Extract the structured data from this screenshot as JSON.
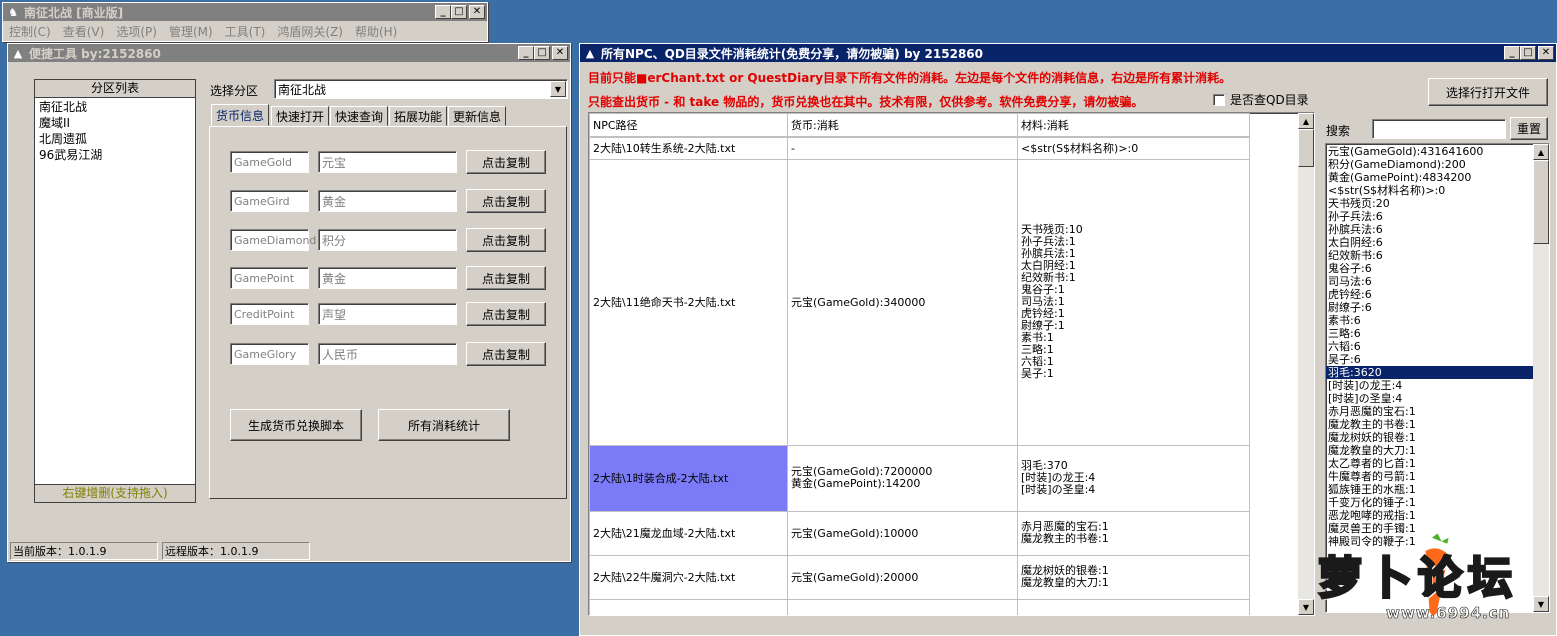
{
  "main_window": {
    "title": "南征北战 [商业版]",
    "menu": [
      "控制(C)",
      "查看(V)",
      "选项(P)",
      "管理(M)",
      "工具(T)",
      "鸿盾网关(Z)",
      "帮助(H)"
    ]
  },
  "tool_window": {
    "title": "便捷工具  by:2152860",
    "partition_list": {
      "header": "分区列表",
      "items": [
        "南征北战",
        "魔域II",
        "北周遗孤",
        "96武易江湖"
      ],
      "footer": "右键增删(支持拖入)"
    },
    "select_label": "选择分区",
    "select_value": "南征北战",
    "tabs": [
      "货币信息",
      "快速打开",
      "快速查询",
      "拓展功能",
      "更新信息"
    ],
    "currency_rows": [
      {
        "code": "GameGold",
        "name": "元宝",
        "button": "点击复制"
      },
      {
        "code": "GameGird",
        "name": "黄金",
        "button": "点击复制"
      },
      {
        "code": "GameDiamond",
        "name": "积分",
        "button": "点击复制"
      },
      {
        "code": "GamePoint",
        "name": "黄金",
        "button": "点击复制"
      },
      {
        "code": "CreditPoint",
        "name": "声望",
        "button": "点击复制"
      },
      {
        "code": "GameGlory",
        "name": "人民币",
        "button": "点击复制"
      }
    ],
    "gen_button": "生成货币兑换脚本",
    "stats_button": "所有消耗统计",
    "status_current": "当前版本：1.0.1.9",
    "status_remote": "远程版本：1.0.1.9"
  },
  "stats_window": {
    "title": "所有NPC、QD目录文件消耗统计(免费分享，请勿被骗)    by 2152860",
    "notice1": "目前只能■erChant.txt or QuestDiary目录下所有文件的消耗。左边是每个文件的消耗信息，右边是所有累计消耗。",
    "notice2": "只能查出货币 - 和 take 物品的，货币兑换也在其中。技术有限，仅供参考。软件免费分享，请勿被骗。",
    "qd_checkbox": "是否查QD目录",
    "open_button": "选择行打开文件",
    "search_label": "搜索",
    "reset_button": "重置",
    "columns": [
      "NPC路径",
      "货币:消耗",
      "材料:消耗"
    ],
    "rows": [
      {
        "path": "2大陆\\10转生系统-2大陆.txt",
        "currency": [
          "-"
        ],
        "materials": [
          "<$str(S$材料名称)>:0"
        ]
      },
      {
        "path": "2大陆\\11绝命天书-2大陆.txt",
        "currency": [
          "元宝(GameGold):340000"
        ],
        "materials": [
          "天书残页:10",
          "孙子兵法:1",
          "孙膑兵法:1",
          "太白阴经:1",
          "纪效新书:1",
          "鬼谷子:1",
          "司马法:1",
          "虎钤经:1",
          "尉缭子:1",
          "素书:1",
          "三略:1",
          "六韬:1",
          "吴子:1"
        ]
      },
      {
        "path": "2大陆\\1时装合成-2大陆.txt",
        "currency": [
          "元宝(GameGold):7200000",
          "黄金(GamePoint):14200"
        ],
        "materials": [
          "羽毛:370",
          "[时装]の龙王:4",
          "[时装]の圣皇:4"
        ]
      },
      {
        "path": "2大陆\\21魔龙血域-2大陆.txt",
        "currency": [
          "元宝(GameGold):10000"
        ],
        "materials": [
          "赤月恶魔的宝石:1",
          "魔龙教主的书卷:1"
        ]
      },
      {
        "path": "2大陆\\22牛魔洞穴-2大陆.txt",
        "currency": [
          "元宝(GameGold):20000"
        ],
        "materials": [
          "魔龙树妖的银卷:1",
          "魔龙教皇的大刀:1"
        ]
      },
      {
        "path": "",
        "currency": [
          ""
        ],
        "materials": [
          "太乙尊者的匕首:1"
        ]
      }
    ],
    "totals": [
      "元宝(GameGold):431641600",
      "积分(GameDiamond):200",
      "黄金(GamePoint):4834200",
      "<$str(S$材料名称)>:0",
      "天书残页:20",
      "孙子兵法:6",
      "孙膑兵法:6",
      "太白阴经:6",
      "纪效新书:6",
      "鬼谷子:6",
      "司马法:6",
      "虎钤经:6",
      "尉缭子:6",
      "素书:6",
      "三略:6",
      "六韬:6",
      "吴子:6",
      "羽毛:3620",
      "[时装]の龙王:4",
      "[时装]の圣皇:4",
      "赤月恶魔的宝石:1",
      "魔龙教主的书卷:1",
      "魔龙树妖的银卷:1",
      "魔龙教皇的大刀:1",
      "太乙尊者的匕首:1",
      "牛魔尊者的弓箭:1",
      "狐族锤王的水瓶:1",
      "千变万化的锤子:1",
      "恶龙咆哮的戒指:1",
      "魔灵兽王的手镯:1",
      "神殿司令的鞭子:1"
    ],
    "selected_total": "羽毛:3620"
  },
  "watermark": {
    "logo_text": "萝卜论坛",
    "url": "www.6994.cn"
  }
}
